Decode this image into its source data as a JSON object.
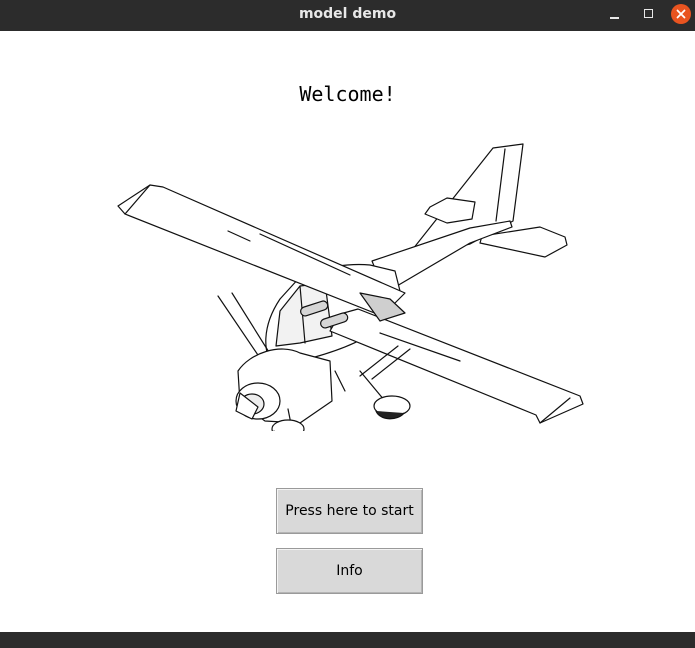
{
  "window": {
    "title": "model demo",
    "controls": [
      "minimize-icon",
      "maximize-icon",
      "close-icon"
    ],
    "close_color": "#e95420",
    "titlebar_color": "#2c2c2c"
  },
  "main": {
    "welcome": "Welcome!",
    "illustration": "airplane-icon",
    "buttons": {
      "start": "Press here to start",
      "info": "Info"
    },
    "button_color": "#d9d9d9"
  }
}
